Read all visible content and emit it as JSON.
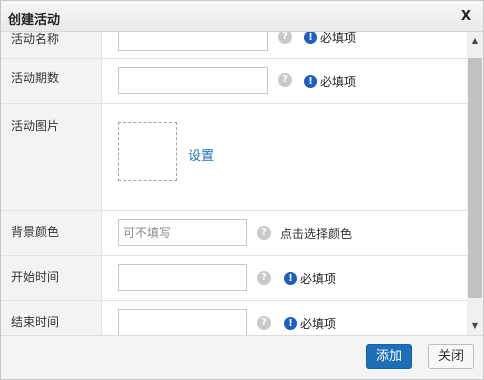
{
  "dialog": {
    "title": "创建活动",
    "close_label": "X"
  },
  "form": {
    "name": {
      "label": "活动名称",
      "value": "",
      "help": "?",
      "required_text": "必填项",
      "required_icon": "!"
    },
    "period": {
      "label": "活动期数",
      "value": "",
      "help": "?",
      "required_text": "必填项",
      "required_icon": "!"
    },
    "image": {
      "label": "活动图片",
      "set_link": "设置"
    },
    "bg_color": {
      "label": "背景颜色",
      "placeholder": "可不填写",
      "help": "?",
      "hint": "点击选择颜色"
    },
    "start_time": {
      "label": "开始时间",
      "value": "",
      "help": "?",
      "required_text": "必填项",
      "required_icon": "!"
    },
    "end_time": {
      "label": "结束时间",
      "value": "",
      "help": "?",
      "required_text": "必填项",
      "required_icon": "!"
    }
  },
  "scrollbar": {
    "up_arrow": "▲",
    "down_arrow": "▼"
  },
  "footer": {
    "add_label": "添加",
    "close_label": "关闭"
  },
  "colors": {
    "primary": "#1d6fb8",
    "required_icon": "#1f5fbf",
    "link": "#1f6fb5"
  }
}
